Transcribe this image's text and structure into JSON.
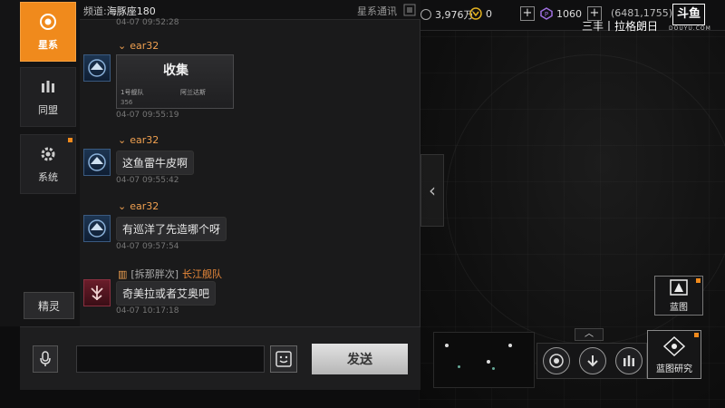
{
  "tabs": [
    {
      "label": "星系",
      "icon": "eye-icon",
      "active": true
    },
    {
      "label": "同盟",
      "icon": "alliance-icon",
      "active": false
    },
    {
      "label": "系统",
      "icon": "gear-icon",
      "active": false
    }
  ],
  "spirit_button": "精灵",
  "chat": {
    "channel_label": "频道:",
    "channel_name": "海豚座180",
    "window_title": "星系通讯",
    "top_time": "04-07 09:52:28",
    "messages": [
      {
        "sender": "ear32",
        "type": "card",
        "card_title": "收集",
        "card_sub1": "1号舰队",
        "card_sub2": "阿兰达斯",
        "card_value": "356",
        "time": "04-07 09:55:19"
      },
      {
        "sender": "ear32",
        "text": "这鱼雷牛皮啊",
        "time": "04-07 09:55:42"
      },
      {
        "sender": "ear32",
        "text": "有巡洋了先造哪个呀",
        "time": "04-07 09:57:54"
      },
      {
        "sender_rank": "[拆那胖次]",
        "sender_fleet": "长江舰队",
        "text": "奇美拉或者艾奥吧",
        "time": "04-07 10:17:18"
      }
    ],
    "send_label": "发送"
  },
  "resources": {
    "credits": "3,976万",
    "vouchers": "0",
    "gems": "1060",
    "coord": "(6481,1755)"
  },
  "overlay": {
    "streamer": "三丰丨拉格朗日",
    "douyu_logo": "斗鱼",
    "douyu_url": "DOUYU.COM"
  },
  "right_buttons": {
    "blueprint": "蓝图",
    "blueprint_research": "蓝图研究"
  },
  "colors": {
    "accent": "#f08a1c",
    "name": "#f0a050"
  }
}
